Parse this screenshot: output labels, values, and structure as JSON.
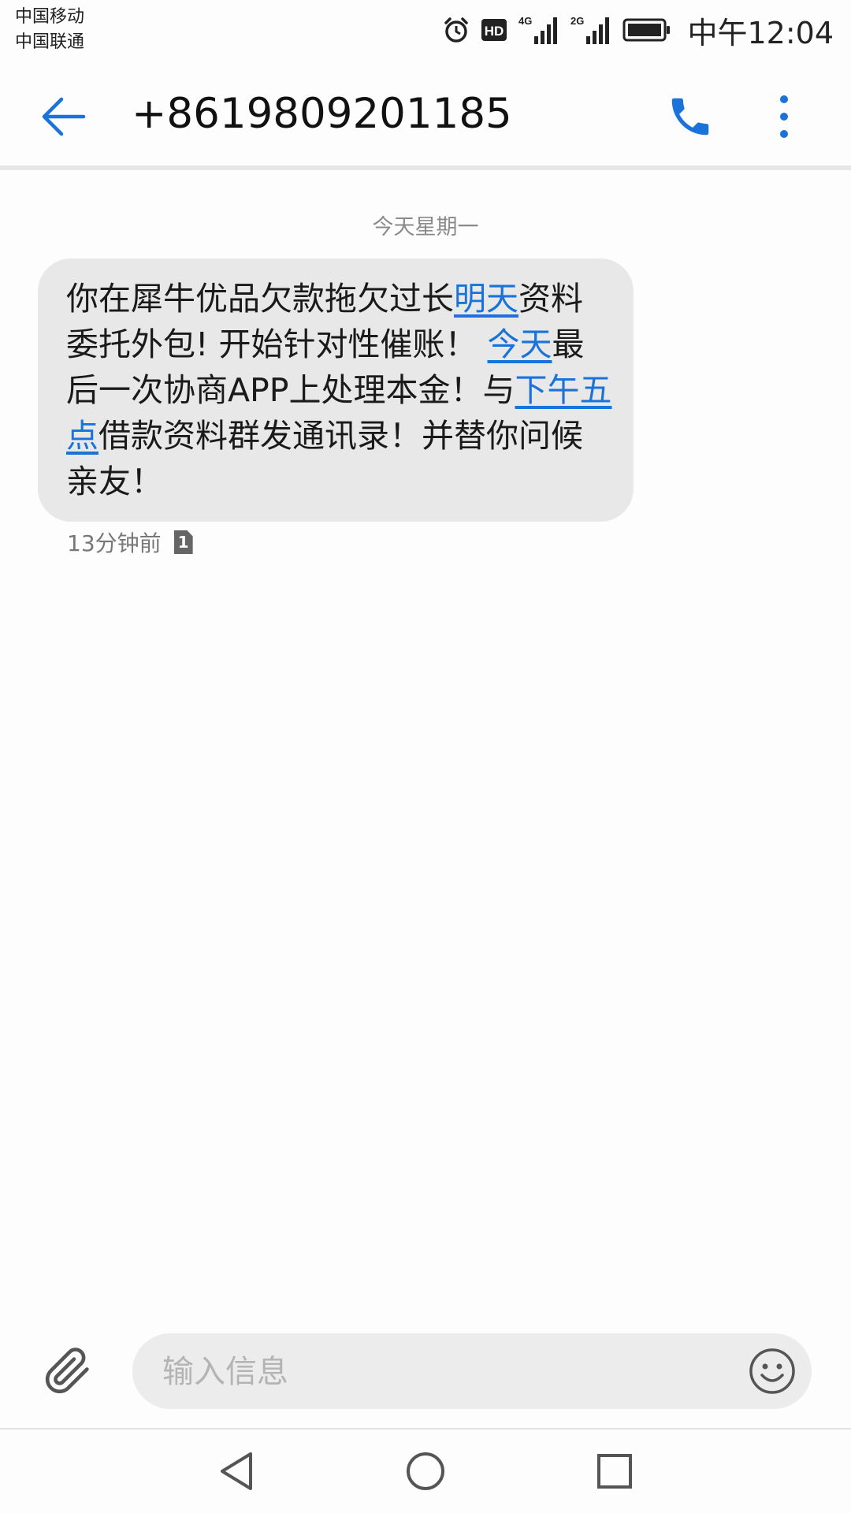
{
  "status_bar": {
    "carrier_1": "中国移动",
    "carrier_2": "中国联通",
    "hd_badge": "HD",
    "network_1": "4G",
    "network_2": "2G",
    "time": "中午12:04",
    "icons": [
      "alarm-icon",
      "hd-icon",
      "signal-4g-icon",
      "signal-2g-icon",
      "battery-icon"
    ]
  },
  "action_bar": {
    "title": "+8619809201185",
    "icons": [
      "arrow-left-icon",
      "phone-icon",
      "more-vertical-icon"
    ]
  },
  "conversation": {
    "date_header": "今天星期一",
    "messages": [
      {
        "segments": {
          "s1": "你在犀牛优品欠款拖欠过长",
          "l1": "明天",
          "s2": "资料委托外包! 开始针对性催账！ ",
          "l2": "今天",
          "s3": "最后一次协商APP上处理本金！与",
          "l3": "下午五点",
          "s4": "借款资料群发通讯录！并替你问候亲友！"
        },
        "time": "13分钟前",
        "sim": "1"
      }
    ]
  },
  "compose": {
    "placeholder": "输入信息",
    "icons": [
      "paperclip-icon",
      "emoji-icon"
    ]
  },
  "nav_bar": {
    "icons": [
      "nav-back-icon",
      "nav-home-icon",
      "nav-recent-icon"
    ]
  },
  "colors": {
    "accent": "#1a73d9",
    "bubble": "#e8e8e8",
    "background": "#fdfdfd"
  }
}
